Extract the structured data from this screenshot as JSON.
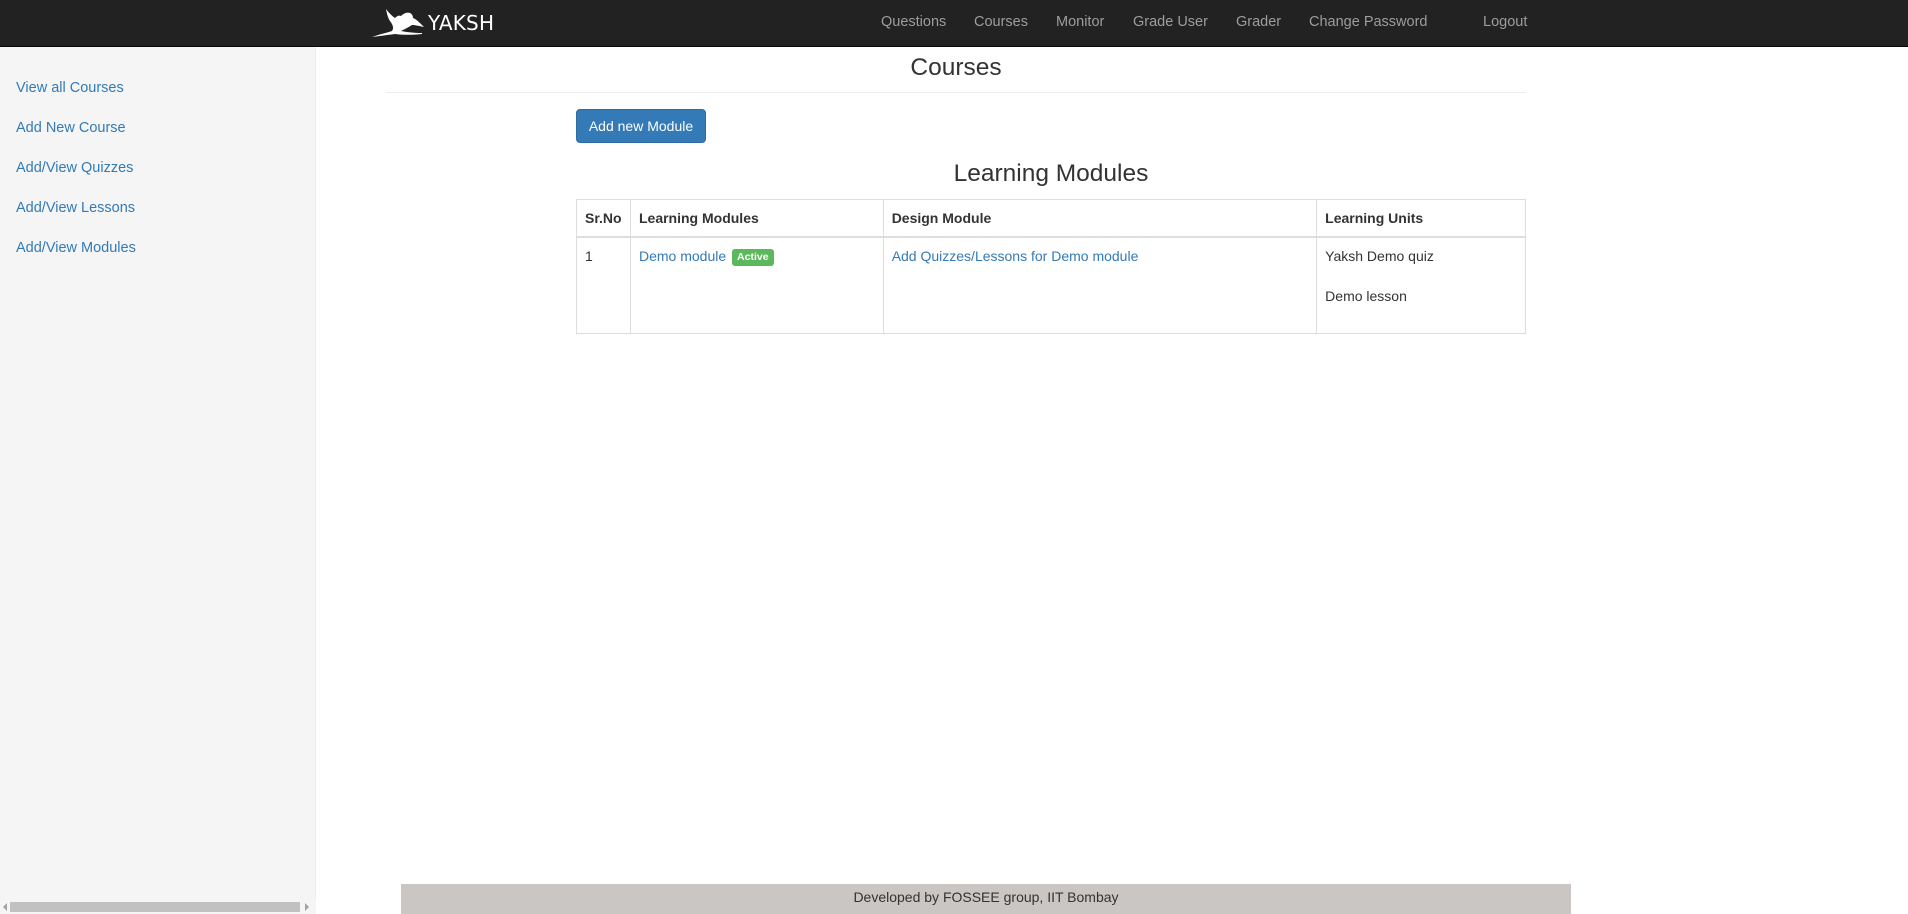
{
  "navbar": {
    "brand": "YAKSH",
    "links": [
      "Questions",
      "Courses",
      "Monitor",
      "Grade User",
      "Grader",
      "Change Password"
    ],
    "logout": "Logout"
  },
  "sidebar": {
    "items": [
      {
        "label": "View all Courses"
      },
      {
        "label": "Add New Course"
      },
      {
        "label": "Add/View Quizzes"
      },
      {
        "label": "Add/View Lessons"
      },
      {
        "label": "Add/View Modules"
      }
    ]
  },
  "main": {
    "title": "Courses",
    "add_module_button": "Add new Module",
    "section_title": "Learning Modules",
    "table": {
      "headers": [
        "Sr.No",
        "Learning Modules",
        "Design Module",
        "Learning Units"
      ],
      "rows": [
        {
          "sr_no": "1",
          "module_name": "Demo module",
          "status_badge": "Active",
          "design_link": "Add Quizzes/Lessons for Demo module",
          "units": [
            "Yaksh Demo quiz",
            "Demo lesson"
          ]
        }
      ]
    }
  },
  "footer": {
    "text": "Developed by FOSSEE group, IIT Bombay"
  },
  "colors": {
    "navbar_bg": "#222222",
    "link": "#337ab7",
    "primary": "#337ab7",
    "badge_success": "#5cb85c",
    "sidebar_bg": "#f5f5f5",
    "footer_bg": "#c9c6c3"
  },
  "icons": {
    "brand_logo": "crane-bird-logo-icon"
  }
}
